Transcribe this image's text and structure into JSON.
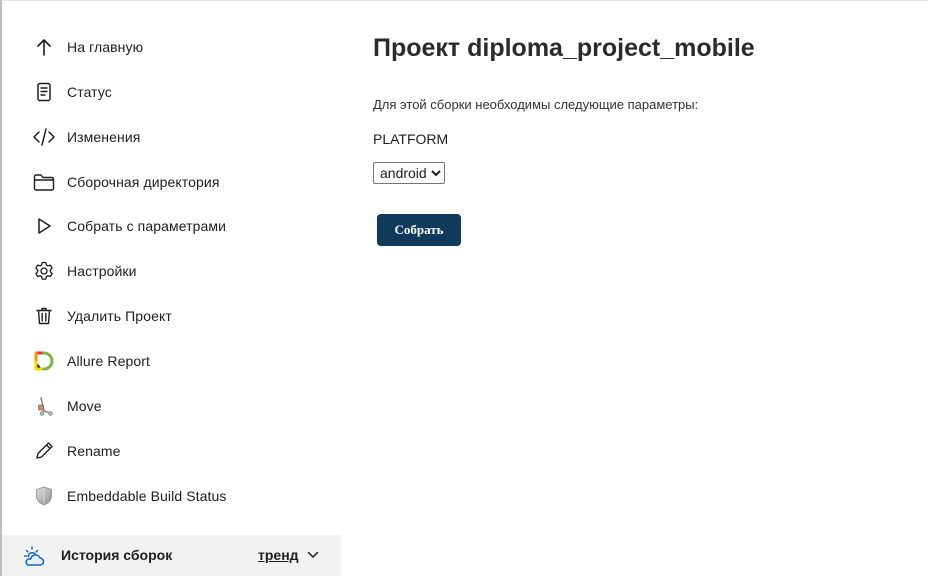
{
  "sidebar": {
    "items": [
      {
        "label": "На главную",
        "icon": "arrow-up-icon"
      },
      {
        "label": "Статус",
        "icon": "document-icon"
      },
      {
        "label": "Изменения",
        "icon": "code-icon"
      },
      {
        "label": "Сборочная директория",
        "icon": "folder-icon"
      },
      {
        "label": "Собрать с параметрами",
        "icon": "play-icon"
      },
      {
        "label": "Настройки",
        "icon": "gear-icon"
      },
      {
        "label": "Удалить Проект",
        "icon": "trash-icon"
      },
      {
        "label": "Allure Report",
        "icon": "allure-icon"
      },
      {
        "label": "Move",
        "icon": "move-icon"
      },
      {
        "label": "Rename",
        "icon": "pencil-icon"
      },
      {
        "label": "Embeddable Build Status",
        "icon": "shield-icon"
      }
    ]
  },
  "history": {
    "label": "История сборок",
    "trend": "тренд",
    "icon": "weather-cloud-sun-icon"
  },
  "main": {
    "title": "Проект diploma_project_mobile",
    "description": "Для этой сборки необходимы следующие параметры:",
    "parameter_name": "PLATFORM",
    "platform_selected": "android",
    "build_button": "Собрать"
  },
  "colors": {
    "button_bg": "#0f3a5c",
    "history_bg": "#f2f2f2",
    "text": "#1e1e1e"
  }
}
